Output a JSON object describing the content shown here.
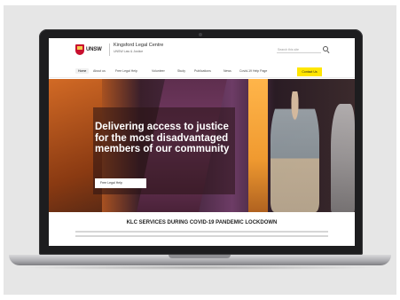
{
  "site": {
    "logo_text": "UNSW",
    "org_title": "Kingsford Legal Centre",
    "org_subtitle": "UNSW Law & Justice",
    "search_placeholder": "Search this site"
  },
  "nav": {
    "items": [
      {
        "label": "Home",
        "active": true
      },
      {
        "label": "About us"
      },
      {
        "label": "Free Legal Help"
      },
      {
        "label": "Volunteer"
      },
      {
        "label": "Study"
      },
      {
        "label": "Publications"
      },
      {
        "label": "News"
      },
      {
        "label": "Covid-19 Help Page"
      }
    ],
    "cta_label": "Contact Us"
  },
  "hero": {
    "heading": "Delivering access to justice for the most disadvantaged members of our community",
    "button_label": "Free Legal Help"
  },
  "notice": {
    "title": "KLC SERVICES DURING COVID-19 PANDEMIC LOCKDOWN"
  },
  "colors": {
    "cta": "#ffe600",
    "brand_red": "#c8102e",
    "laptop_bezel": "#1d1d1f"
  }
}
